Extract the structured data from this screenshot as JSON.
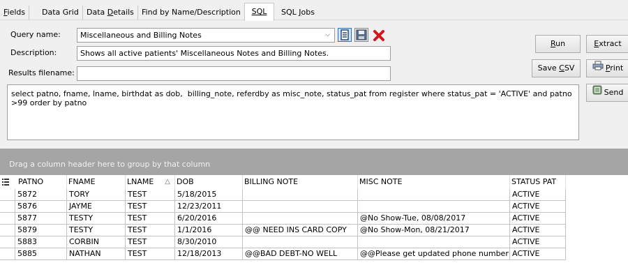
{
  "tabs": [
    {
      "pre": "",
      "u": "F",
      "post": "ields"
    },
    {
      "pre": "Data Grid",
      "u": "",
      "post": ""
    },
    {
      "pre": "Data ",
      "u": "D",
      "post": "etails"
    },
    {
      "pre": "Find by Name/Description",
      "u": "",
      "post": ""
    },
    {
      "pre": "",
      "u": "SQL",
      "post": ""
    },
    {
      "pre": "SQL ",
      "u": "J",
      "post": "obs"
    }
  ],
  "form": {
    "query_label": "Query name:",
    "query_value": "Miscellaneous and Billing Notes",
    "description_label": "Description:",
    "description_value": "Shows all active patients' Miscellaneous Notes and Billing Notes.",
    "results_label": "Results filename:",
    "results_value": "",
    "sql": "select patno, fname, lname, birthdat as dob,  billing_note, referdby as misc_note, status_pat from register where status_pat = 'ACTIVE' and patno >99 order by patno"
  },
  "buttons": {
    "run": {
      "pre": "",
      "u": "R",
      "post": "un"
    },
    "extract": {
      "pre": "",
      "u": "E",
      "post": "xtract"
    },
    "save_csv": {
      "pre": "Save ",
      "u": "C",
      "post": "SV"
    },
    "print": {
      "pre": "",
      "u": "P",
      "post": "rint"
    },
    "send": {
      "pre": "Send",
      "u": "",
      "post": ""
    }
  },
  "group_panel_text": "Drag a column header here to group by that column",
  "grid": {
    "columns": [
      "PATNO",
      "FNAME",
      "LNAME",
      "DOB",
      "BILLING NOTE",
      "MISC NOTE",
      "STATUS PAT"
    ],
    "rows": [
      [
        "5872",
        "TORY",
        "TEST",
        "5/18/2015",
        "",
        "",
        "ACTIVE"
      ],
      [
        "5876",
        "JAYME",
        "TEST",
        "12/23/2011",
        "",
        "",
        "ACTIVE"
      ],
      [
        "5877",
        "TESTY",
        "TEST",
        "6/20/2016",
        "",
        "@No Show-Tue, 08/08/2017",
        "ACTIVE"
      ],
      [
        "5879",
        "TESTY",
        "TEST",
        "1/1/2016",
        "@@ NEED INS CARD COPY",
        "@No Show-Mon, 08/21/2017",
        "ACTIVE"
      ],
      [
        "5883",
        "CORBIN",
        "TEST",
        "8/30/2010",
        "",
        "",
        "ACTIVE"
      ],
      [
        "5885",
        "NATHAN",
        "TEST",
        "12/18/2013",
        "@@BAD DEBT-NO WELL",
        "@@Please get updated phone number",
        "ACTIVE"
      ]
    ]
  },
  "icons": {
    "open_query": "open-query-icon",
    "save_query": "save-query-icon",
    "delete_query": "delete-query-icon",
    "printer": "printer-icon",
    "send": "send-icon",
    "sort_asc": "sort-ascending-icon",
    "column_chooser": "column-chooser-icon"
  },
  "colors": {
    "accent": "#2f6fb7",
    "delete": "#d4141b",
    "group_panel": "#a5a5a5"
  }
}
